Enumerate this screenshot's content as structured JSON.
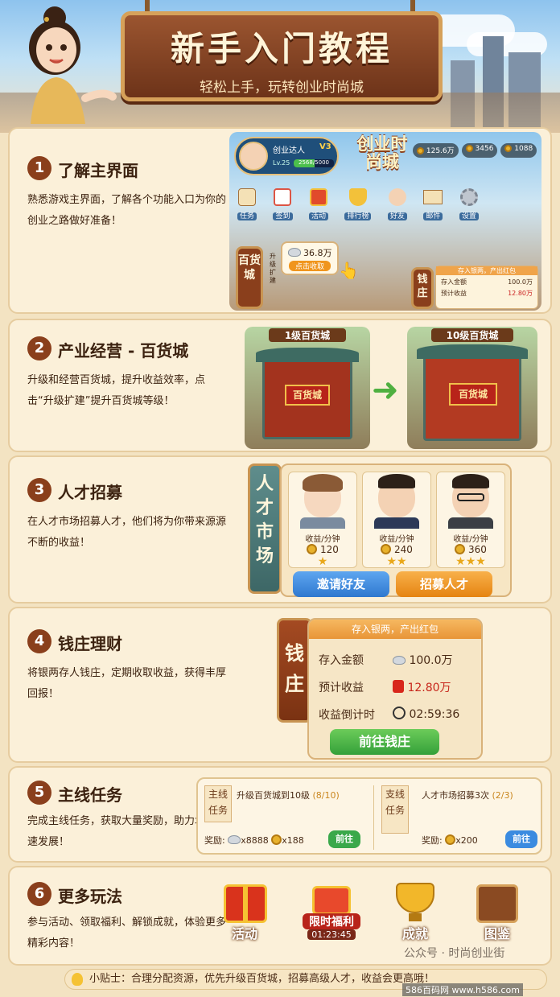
{
  "header": {
    "title": "新手入门教程",
    "subtitle": "轻松上手，玩转创业时尚城"
  },
  "sections": [
    {
      "num": "1",
      "title": "了解主界面",
      "desc": "熟悉游戏主界面，了解各个功能入口为你的创业之路做好准备！"
    },
    {
      "num": "2",
      "title": "产业经营 - 百货城",
      "desc": "升级和经营百货城，提升收益效率，点击“升级扩建”提升百货城等级！"
    },
    {
      "num": "3",
      "title": "人才招募",
      "desc": "在人才市场招募人才，他们将为你带来源源不断的收益！"
    },
    {
      "num": "4",
      "title": "钱庄理财",
      "desc": "将银两存人钱庄，定期收取收益，获得丰厚回报！"
    },
    {
      "num": "5",
      "title": "主线任务",
      "desc": "完成主线任务，获取大量奖励，助力城市快速发展！"
    },
    {
      "num": "6",
      "title": "更多玩法",
      "desc": "参与活动、领取福利、解锁成就，体验更多精彩内容！"
    }
  ],
  "main_ui": {
    "player_name": "创业达人",
    "vip": "V3",
    "level": "Lv.25",
    "exp": "2568/5000",
    "logo": "创业时尚城",
    "currency": [
      "125.6万",
      "3456",
      "1088"
    ],
    "menu": [
      "任务",
      "签到",
      "活动",
      "排行榜",
      "好友",
      "邮件",
      "设置"
    ],
    "collect_amount": "36.8万",
    "collect_label": "点击收取",
    "store_sign": "百货城",
    "store_side": "升级扩建",
    "bank_sign": "钱庄",
    "bank_header": "存入银两，产出红包",
    "bank_rows": [
      {
        "label": "存入金额",
        "value": "100.0万"
      },
      {
        "label": "预计收益",
        "value": "12.80万"
      }
    ]
  },
  "store_upgrade": {
    "before": "1级百货城",
    "after": "10级百货城",
    "sign": "百货城"
  },
  "talent": {
    "market_label": "人才市场",
    "cards": [
      {
        "label": "收益/分钟",
        "value": "120",
        "stars": "★"
      },
      {
        "label": "收益/分钟",
        "value": "240",
        "stars": "★★"
      },
      {
        "label": "收益/分钟",
        "value": "360",
        "stars": "★★★"
      }
    ],
    "invite_button": "邀请好友",
    "recruit_button": "招募人才"
  },
  "bank": {
    "plaque": "钱庄",
    "header": "存入银两，产出红包",
    "rows": [
      {
        "label": "存入金额",
        "value": "100.0万"
      },
      {
        "label": "预计收益",
        "value": "12.80万"
      },
      {
        "label": "收益倒计时",
        "value": "02:59:36"
      }
    ],
    "go_button": "前往钱庄"
  },
  "quests": [
    {
      "tag": "主线任务",
      "title": "升级百货城到10级",
      "progress": "(8/10)",
      "reward_label": "奖励:",
      "rewards": [
        "x8888",
        "x188"
      ],
      "button": "前往"
    },
    {
      "tag": "支线任务",
      "title": "人才市场招募3次",
      "progress": "(2/3)",
      "reward_label": "奖励:",
      "rewards": [
        "x200"
      ],
      "button": "前往"
    }
  ],
  "features": [
    {
      "label": "活动",
      "icon": "gift-icon"
    },
    {
      "label": "限时福利",
      "timer": "01:23:45",
      "icon": "limited-gift-icon"
    },
    {
      "label": "成就",
      "icon": "trophy-icon"
    },
    {
      "label": "图鉴",
      "icon": "book-icon"
    }
  ],
  "tip": "小贴士：合理分配资源，优先升级百货城，招募高级人才，收益会更高哦！",
  "watermark": "公众号 · 时尚创业街",
  "watermark2": "586百码网 www.h586.com",
  "colors": {
    "primary_brown": "#8a3f1c",
    "blue_button": "#3b8be0",
    "orange_button": "#f0951d",
    "green_button": "#3aa84a"
  }
}
